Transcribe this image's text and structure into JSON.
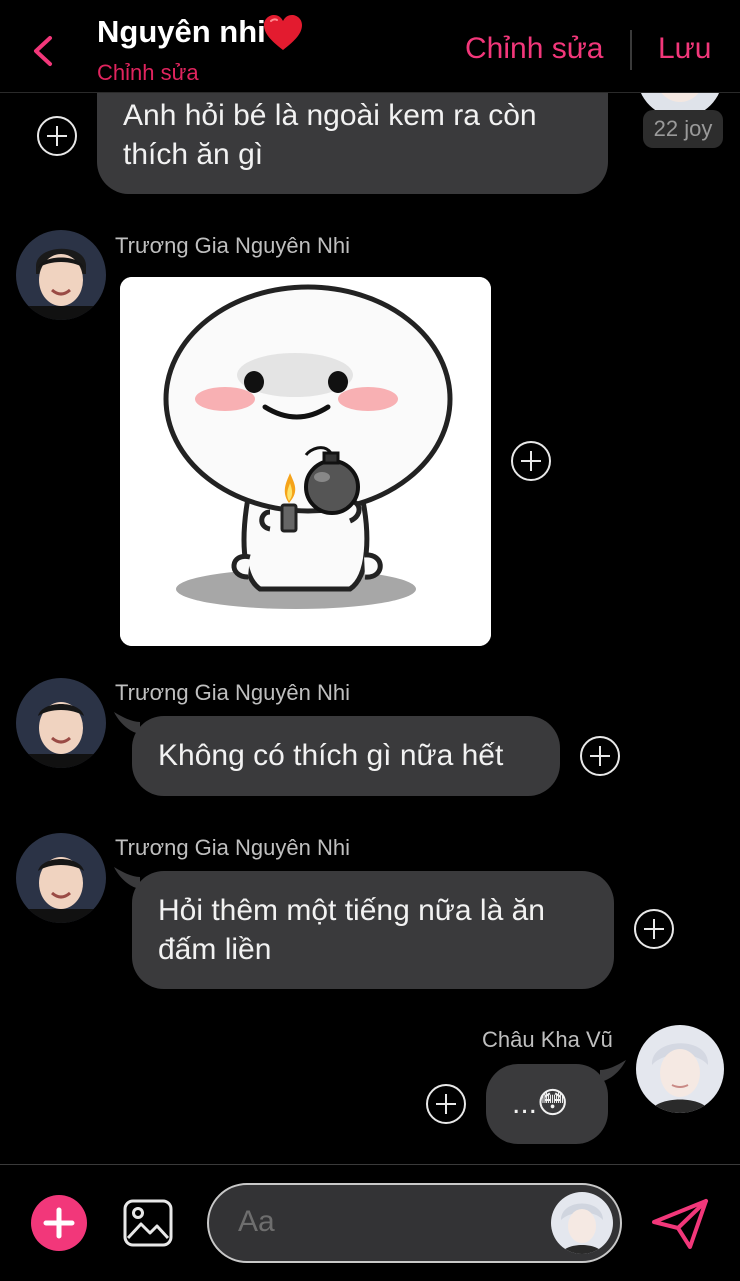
{
  "header": {
    "title": "Nguyên nhi",
    "subtitle": "Chỉnh sửa",
    "edit_label": "Chỉnh sửa",
    "save_label": "Lưu",
    "back_icon": "chevron-left-icon",
    "heart_icon": "red-heart-emoji",
    "accent_color": "#f2377a"
  },
  "messages": [
    {
      "id": "m1",
      "direction": "incoming",
      "text": "Anh hỏi bé là ngoài kem ra còn thích ăn gì",
      "badge": "22 joy"
    },
    {
      "id": "m2",
      "direction": "incoming",
      "sender": "Trương Gia Nguyên Nhi",
      "type": "sticker",
      "sticker": "white-blob-holding-bomb-sticker"
    },
    {
      "id": "m3",
      "direction": "incoming",
      "sender": "Trương Gia Nguyên Nhi",
      "text": "Không có thích gì nữa hết"
    },
    {
      "id": "m4",
      "direction": "incoming",
      "sender": "Trương Gia Nguyên Nhi",
      "text": "Hỏi thêm một tiếng nữa là ăn đấm liền"
    },
    {
      "id": "m5",
      "direction": "outgoing",
      "sender": "Châu Kha Vũ",
      "text": "...😳"
    }
  ],
  "composer": {
    "placeholder": "Aa",
    "add_icon": "plus-icon",
    "image_icon": "image-icon",
    "send_icon": "send-icon"
  }
}
